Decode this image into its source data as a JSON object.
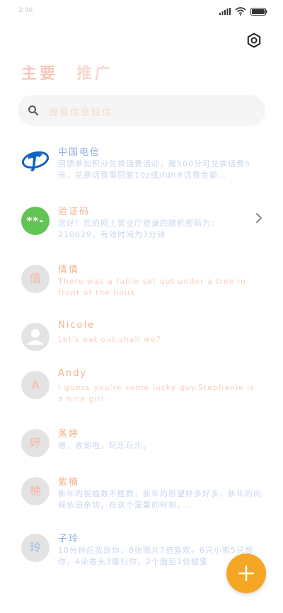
{
  "status_bar": {
    "time": "2:36"
  },
  "header": {
    "title_primary": "主要",
    "title_secondary": "推广"
  },
  "search": {
    "placeholder": "搜索信息短信"
  },
  "messages": [
    {
      "sender": "中国电信",
      "time": "",
      "preview": "回馈参加积分兑换话费活动，赠500分可兑换话费5元，兑换话费需回复10z或jfdh#话费金额…",
      "avatar": ""
    },
    {
      "sender": "验证码",
      "time": "",
      "preview": "您好！您的网上营业厅登录的随机密码为：210629，有效时间为3分钟",
      "avatar": "**-"
    },
    {
      "sender": "倩倩",
      "time": "",
      "preview": "There was a table set out under a tree in front of the hous",
      "avatar": "倩"
    },
    {
      "sender": "Nicole",
      "time": "",
      "preview": "Let's eat out,shall we?",
      "avatar": ""
    },
    {
      "sender": "Andy",
      "time": "",
      "preview": "I guess you're some lucky guy.Stephanie is a nice girl.",
      "avatar": "A"
    },
    {
      "sender": "蒸婷",
      "time": "",
      "preview": "嗯，收到啦，玩乐玩乐。",
      "avatar": "婷"
    },
    {
      "sender": "紫楠",
      "time": "",
      "preview": "新年的祝福数不胜数，新年的愿望好多好多，新年的问候依旧亲切，在这个温馨的时刻，…",
      "avatar": "楠"
    },
    {
      "sender": "子玲",
      "time": "",
      "preview": "10分钟后我到你，8张照片7倍喜欢，6只小熊5只想你，4朵香头3瓣归你，2个面包1份甜蜜",
      "avatar": "玲"
    }
  ],
  "colors": {
    "accent": "#f5a623",
    "online": "#61c454",
    "title": "#f7c7bd"
  },
  "fab": {
    "icon": "plus-icon"
  }
}
